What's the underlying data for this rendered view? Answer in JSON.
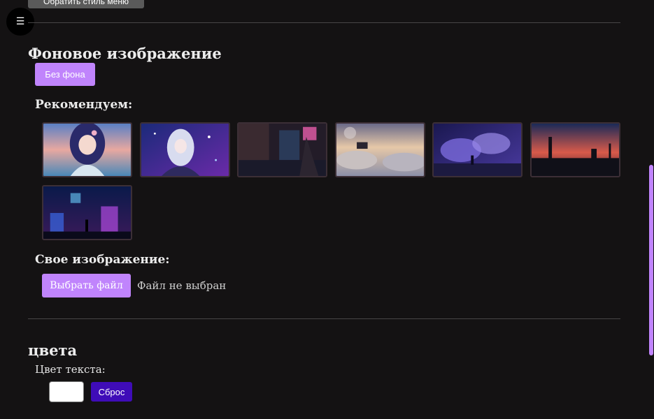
{
  "top_button": {
    "label": "Обратить стиль меню"
  },
  "menu": {
    "icon": "hamburger-icon",
    "glyph": "☰"
  },
  "background_section": {
    "title": "Фоновое изображение",
    "no_background_label": "Без фона",
    "recommended_label": "Рекомендуем:",
    "thumbnails": [
      {
        "name": "anime-girl-sunset-sea"
      },
      {
        "name": "anime-girl-silver-hair-night"
      },
      {
        "name": "city-rain-night"
      },
      {
        "name": "piano-clouds-sky"
      },
      {
        "name": "purple-clouds-fantasy"
      },
      {
        "name": "sunset-pier-silhouette"
      },
      {
        "name": "neon-city-figure"
      }
    ],
    "custom_image_label": "Свое изображение:",
    "choose_file_label": "Выбрать файл",
    "file_status": "Файл не выбран"
  },
  "colors_section": {
    "title": "цвета",
    "text_color_label": "Цвет текста:",
    "text_color_value": "#ffffff",
    "reset_label": "Сброс"
  },
  "theme": {
    "accent": "#c084fc",
    "reset_button": "#3f0cb8",
    "background": "#141213"
  }
}
